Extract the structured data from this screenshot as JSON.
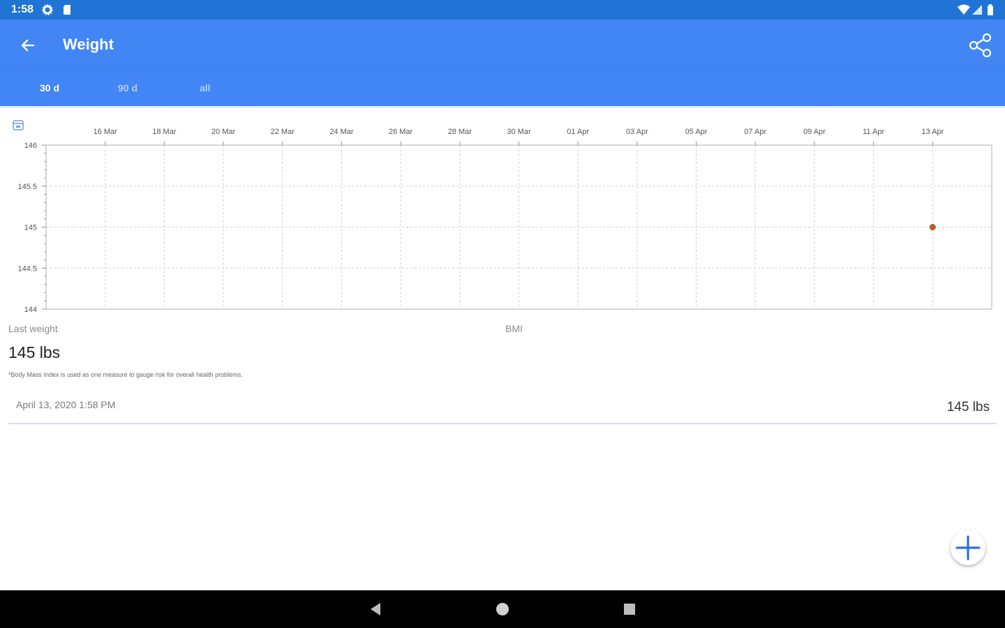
{
  "status_bar": {
    "time": "1:58",
    "icons": [
      "settings-icon",
      "sd-card-icon",
      "wifi-icon",
      "signal-icon",
      "battery-icon"
    ]
  },
  "app_bar": {
    "title": "Weight",
    "back_icon": "arrow-left-icon",
    "share_icon": "share-icon"
  },
  "tabs": [
    {
      "label": "30 d",
      "active": true
    },
    {
      "label": "90 d",
      "active": false
    },
    {
      "label": "all",
      "active": false
    }
  ],
  "chart_data": {
    "type": "scatter",
    "x_tick_labels": [
      "16 Mar",
      "18 Mar",
      "20 Mar",
      "22 Mar",
      "24 Mar",
      "26 Mar",
      "28 Mar",
      "30 Mar",
      "01 Apr",
      "03 Apr",
      "05 Apr",
      "07 Apr",
      "09 Apr",
      "11 Apr",
      "13 Apr"
    ],
    "y_tick_labels": [
      "146",
      "145.5",
      "145",
      "144.5",
      "144"
    ],
    "ylim": [
      144,
      146
    ],
    "xlim": [
      "2020-03-14",
      "2020-04-15"
    ],
    "grid": true,
    "series": [
      {
        "points": [
          {
            "x": "2020-04-13",
            "y": 145
          }
        ],
        "color": "#e64a19"
      }
    ]
  },
  "summary": {
    "last_weight_label": "Last weight",
    "last_weight_value": "145 lbs",
    "bmi_label": "BMI",
    "bmi_note": "*Body Mass Index is used as one measure to gauge risk for overall health problems."
  },
  "entries": [
    {
      "date": "April 13, 2020 1:58 PM",
      "value": "145 lbs"
    }
  ],
  "fab": {
    "icon": "plus-icon"
  },
  "nav_bar": {
    "icons": [
      "back-triangle-icon",
      "home-circle-icon",
      "recents-square-icon"
    ]
  }
}
